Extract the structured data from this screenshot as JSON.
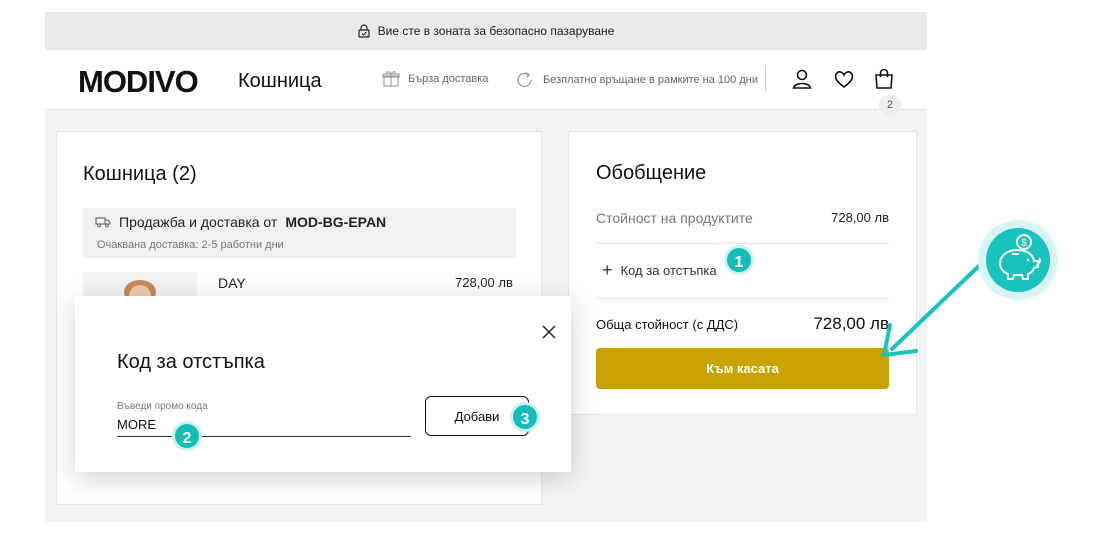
{
  "topbar": {
    "secure_text": "Вие сте в зоната за безопасно пазаруване",
    "icon": "lock-icon"
  },
  "header": {
    "logo": "MODIVO",
    "title": "Кошница",
    "perks": [
      {
        "icon": "gift-icon",
        "label": "Бърза доставка"
      },
      {
        "icon": "return-icon",
        "label": "Безплатно връщане в рамките на 100 дни"
      }
    ],
    "bag_count": "2"
  },
  "cart": {
    "title": "Кошница (2)",
    "seller_prefix": "Продажба и доставка от",
    "seller_name": "MOD-BG-EPAN",
    "delivery": "Очаквана доставка: 2-5 работни дни",
    "product": {
      "name": "DAY",
      "price": "728,00 лв"
    }
  },
  "summary": {
    "title": "Обобщение",
    "products_label": "Стойност на продуктите",
    "products_value": "728,00 лв",
    "discount_label": "Код за отстъпка",
    "total_label": "Обща стойност (с ДДС)",
    "total_value": "728,00 лв",
    "checkout_label": "Към касата",
    "accent_color": "#c9a300"
  },
  "modal": {
    "title": "Код за отстъпка",
    "input_label": "Въведи промо кода",
    "input_value": "MORE",
    "add_label": "Добави"
  },
  "annotations": {
    "step1": "1",
    "step2": "2",
    "step3": "3",
    "accent_color": "#14bdb8"
  }
}
